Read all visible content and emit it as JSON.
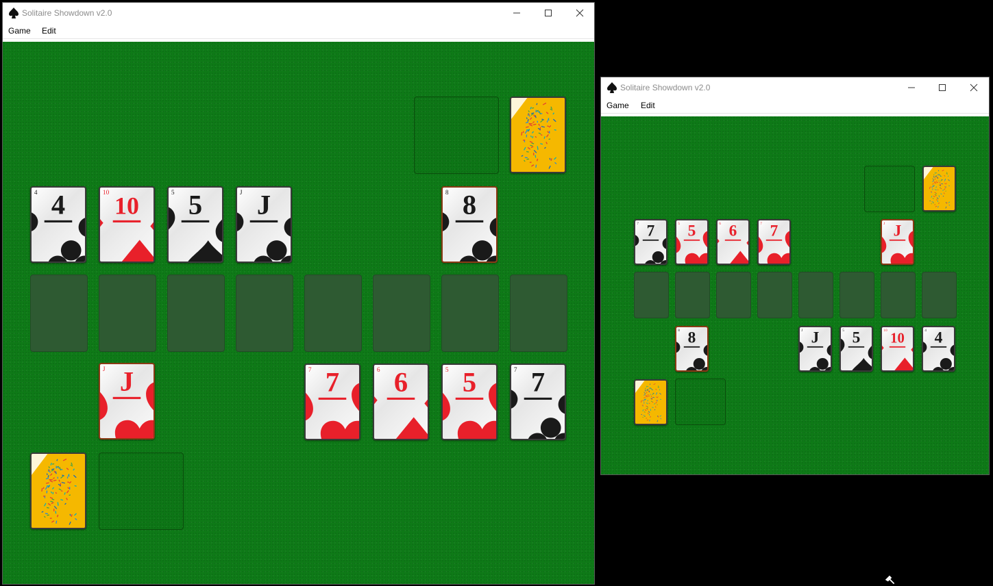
{
  "windows": {
    "main": {
      "title": "Solitaire Showdown v2.0",
      "menu": [
        "Game",
        "Edit"
      ],
      "card_rows": [
        [
          {
            "rank": "4",
            "suit": "clubs"
          },
          {
            "rank": "10",
            "suit": "diamonds"
          },
          {
            "rank": "5",
            "suit": "spades"
          },
          {
            "rank": "J",
            "suit": "clubs"
          }
        ],
        [
          {
            "rank": "8",
            "suit": "clubs",
            "selected": true
          }
        ],
        [
          {
            "rank": "J",
            "suit": "hearts",
            "selected": true
          }
        ],
        [
          {
            "rank": "7",
            "suit": "hearts"
          },
          {
            "rank": "6",
            "suit": "diamonds"
          },
          {
            "rank": "5",
            "suit": "hearts"
          },
          {
            "rank": "7",
            "suit": "clubs"
          }
        ]
      ],
      "empty_tableau_slots": 8
    },
    "secondary": {
      "title": "Solitaire Showdown v2.0",
      "menu": [
        "Game",
        "Edit"
      ],
      "card_rows": [
        [
          {
            "rank": "7",
            "suit": "clubs"
          },
          {
            "rank": "5",
            "suit": "hearts"
          },
          {
            "rank": "6",
            "suit": "diamonds"
          },
          {
            "rank": "7",
            "suit": "hearts"
          }
        ],
        [
          {
            "rank": "J",
            "suit": "hearts",
            "selected": true
          }
        ],
        [
          {
            "rank": "8",
            "suit": "clubs",
            "selected": true
          }
        ],
        [
          {
            "rank": "J",
            "suit": "clubs"
          },
          {
            "rank": "5",
            "suit": "spades"
          },
          {
            "rank": "10",
            "suit": "diamonds"
          },
          {
            "rank": "4",
            "suit": "clubs"
          }
        ]
      ],
      "empty_tableau_slots": 8
    }
  },
  "icons": {
    "app": "spade-icon",
    "minimize": "minimize-icon",
    "maximize": "maximize-icon",
    "close": "close-icon",
    "cursor": "mouse-pointer-icon"
  },
  "colors": {
    "felt": "#0e7a17",
    "empty_slot": "#2e5a32",
    "card_back": "#f5b800",
    "selected_border": "#8a3a14",
    "red_suit": "#e8202a",
    "black_suit": "#1a1a1a"
  }
}
